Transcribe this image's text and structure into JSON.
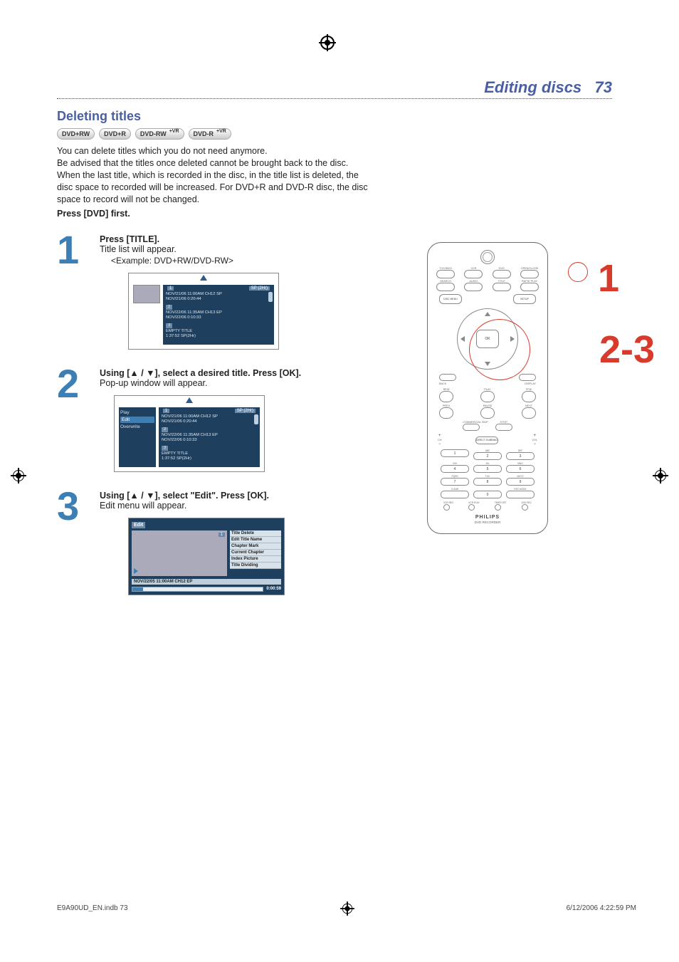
{
  "header": {
    "title": "Editing discs",
    "page_number": "73"
  },
  "section": {
    "title": "Deleting titles"
  },
  "badges": [
    {
      "label": "DVD+RW",
      "vr": ""
    },
    {
      "label": "DVD+R",
      "vr": ""
    },
    {
      "label": "DVD-RW",
      "vr": "+VR"
    },
    {
      "label": "DVD-R",
      "vr": "+VR"
    }
  ],
  "intro": {
    "p1": "You can delete titles which you do not need anymore.",
    "p2": "Be advised that the titles once deleted cannot be brought back to the disc.",
    "p3": "When the last title, which is recorded in the disc, in the title list is deleted, the disc space to recorded will be increased. For DVD+R and DVD-R disc, the disc space to record will not be changed.",
    "press_first": "Press [DVD] first."
  },
  "steps": {
    "one": {
      "num": "1",
      "title": "Press [TITLE].",
      "sub": "Title list will appear.",
      "example": "<Example: DVD+RW/DVD-RW>"
    },
    "two": {
      "num": "2",
      "title": "Using [▲ / ▼], select a desired title. Press [OK].",
      "sub": "Pop-up window will appear."
    },
    "three": {
      "num": "3",
      "title": "Using [▲ / ▼], select \"Edit\". Press [OK].",
      "sub": "Edit menu will appear."
    }
  },
  "title_list": {
    "sp_label": "SP (2Hr)",
    "entries": [
      {
        "idx": "1",
        "line1": "NOV/21/06  11:00AM CH12  SP",
        "line2": "NOV/21/06    0:20:44"
      },
      {
        "idx": "2",
        "line1": "NOV/22/06  11:35AM CH13  EP",
        "line2": "NOV/22/06    0:10:33"
      },
      {
        "idx": "3",
        "line1": "EMPTY TITLE",
        "line2": "1:37:52  SP(2Hr)"
      }
    ]
  },
  "popup_sidebar": [
    "Play",
    "Edit",
    "Overwrite"
  ],
  "edit_box": {
    "title": "Edit",
    "preview_idx": "1",
    "menu": [
      "Title Delete",
      "Edit Title Name",
      "Chapter Mark",
      "Current Chapter",
      "Index Picture",
      "Title Dividing"
    ],
    "meta": "NOV/22/05 11:00AM CH12 EP",
    "time": "0:00:59"
  },
  "remote": {
    "top_labels": [
      "TV/VIDEO",
      "VCR",
      "DVD",
      "OPEN/CLOSE"
    ],
    "row2_labels": [
      "SEARCH",
      "AUDIO",
      "TITLE",
      "RAPID PLAY"
    ],
    "disc_menu": "DISC MENU",
    "setup": "SETUP",
    "ok": "OK",
    "back": "BACK",
    "display": "DISPLAY",
    "play_row_labels": [
      "REW",
      "PLAY",
      "FFW"
    ],
    "prev_row_labels": [
      "PREV",
      "PAUSE",
      "NEXT"
    ],
    "skip_stop_labels": [
      "COMMERCIAL SKIP",
      "STOP"
    ],
    "vol_labels": [
      "CH",
      "VOL"
    ],
    "dubbing": "DIRECT DUBBING",
    "keypad_top_labels": [
      "",
      "ABC",
      "DEF"
    ],
    "keypad_mid_labels": [
      "GHI",
      "JKL",
      "MNO"
    ],
    "keypad_bot_labels": [
      "PQRS",
      "TUV",
      "WXYZ"
    ],
    "last_row": [
      "CLEAR",
      "0",
      "REC MODE"
    ],
    "dot_labels": [
      "VCR REC",
      "VCR PLAY",
      "TIMER SET",
      "DVD REC"
    ],
    "brand": "PHILIPS",
    "subbrand": "DVD RECORDER"
  },
  "remote_callouts": {
    "n1": "1",
    "n23": "2-3"
  },
  "footer": {
    "left": "E9A90UD_EN.indb   73",
    "right": "6/12/2006   4:22:59 PM"
  }
}
